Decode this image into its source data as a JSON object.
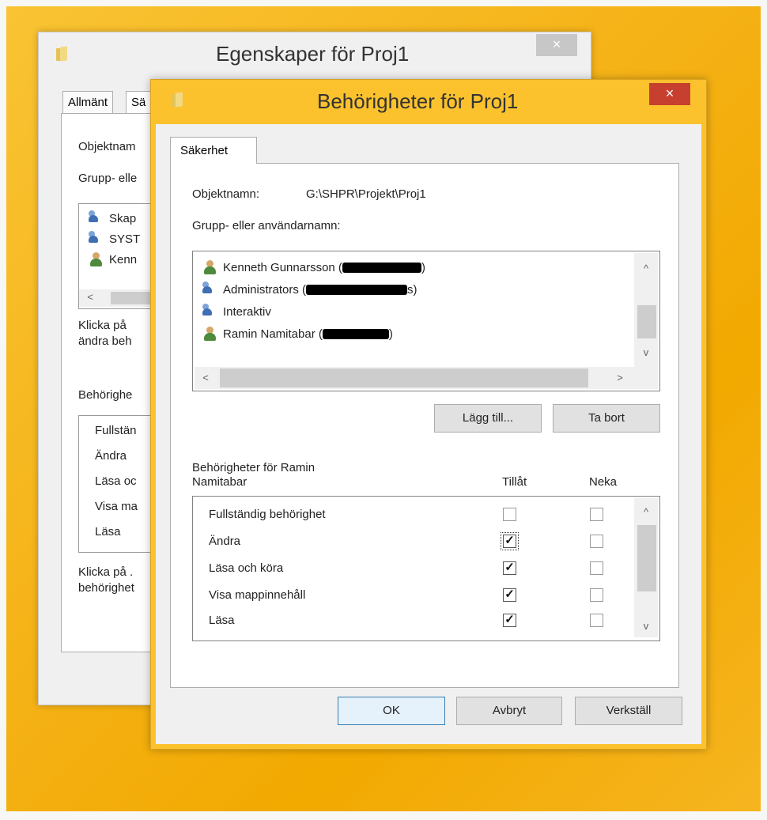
{
  "back_window": {
    "title": "Egenskaper för Proj1",
    "close_glyph": "×",
    "tabs": [
      "Allmänt",
      "Sä"
    ],
    "labels": {
      "object_name": "Objektnam",
      "group": "Grupp- elle",
      "click_change": "Klicka på",
      "change_perm": "ändra beh",
      "permissions": "Behörighe",
      "click_adv": "Klicka på .",
      "adv": "behörighet"
    },
    "users": [
      "Skap",
      "SYST",
      "Kenn"
    ],
    "perms": [
      "Fullstän",
      "Ändra",
      "Läsa oc",
      "Visa ma",
      "Läsa"
    ],
    "scroll_left": "<"
  },
  "front_window": {
    "title": "Behörigheter för Proj1",
    "close_glyph": "×",
    "tab": "Säkerhet",
    "object_name_label": "Objektnamn:",
    "object_name_value": "G:\\SHPR\\Projekt\\Proj1",
    "group_label": "Grupp- eller användarnamn:",
    "users": [
      {
        "name": "Kenneth Gunnarsson (",
        "suffix": ")",
        "icon": "user-icon"
      },
      {
        "name": "Administrators (",
        "suffix": "s)",
        "icon": "group-icon"
      },
      {
        "name": "Interaktiv",
        "suffix": "",
        "icon": "group-icon"
      },
      {
        "name": "Ramin Namitabar (",
        "suffix": ")",
        "icon": "user-icon"
      }
    ],
    "scroll_up": "^",
    "scroll_down": "v",
    "scroll_left": "<",
    "scroll_right": ">",
    "add_button": "Lägg till...",
    "remove_button": "Ta bort",
    "perms_for_line1": "Behörigheter för Ramin",
    "perms_for_line2": "Namitabar",
    "allow_header": "Tillåt",
    "deny_header": "Neka",
    "permissions": [
      {
        "label": "Fullständig behörighet",
        "allow": false,
        "deny": false
      },
      {
        "label": "Ändra",
        "allow": true,
        "deny": false
      },
      {
        "label": "Läsa och köra",
        "allow": true,
        "deny": false
      },
      {
        "label": "Visa mappinnehåll",
        "allow": true,
        "deny": false
      },
      {
        "label": "Läsa",
        "allow": true,
        "deny": false
      }
    ],
    "check_glyph": "✓",
    "ok_button": "OK",
    "cancel_button": "Avbryt",
    "apply_button": "Verkställ"
  }
}
